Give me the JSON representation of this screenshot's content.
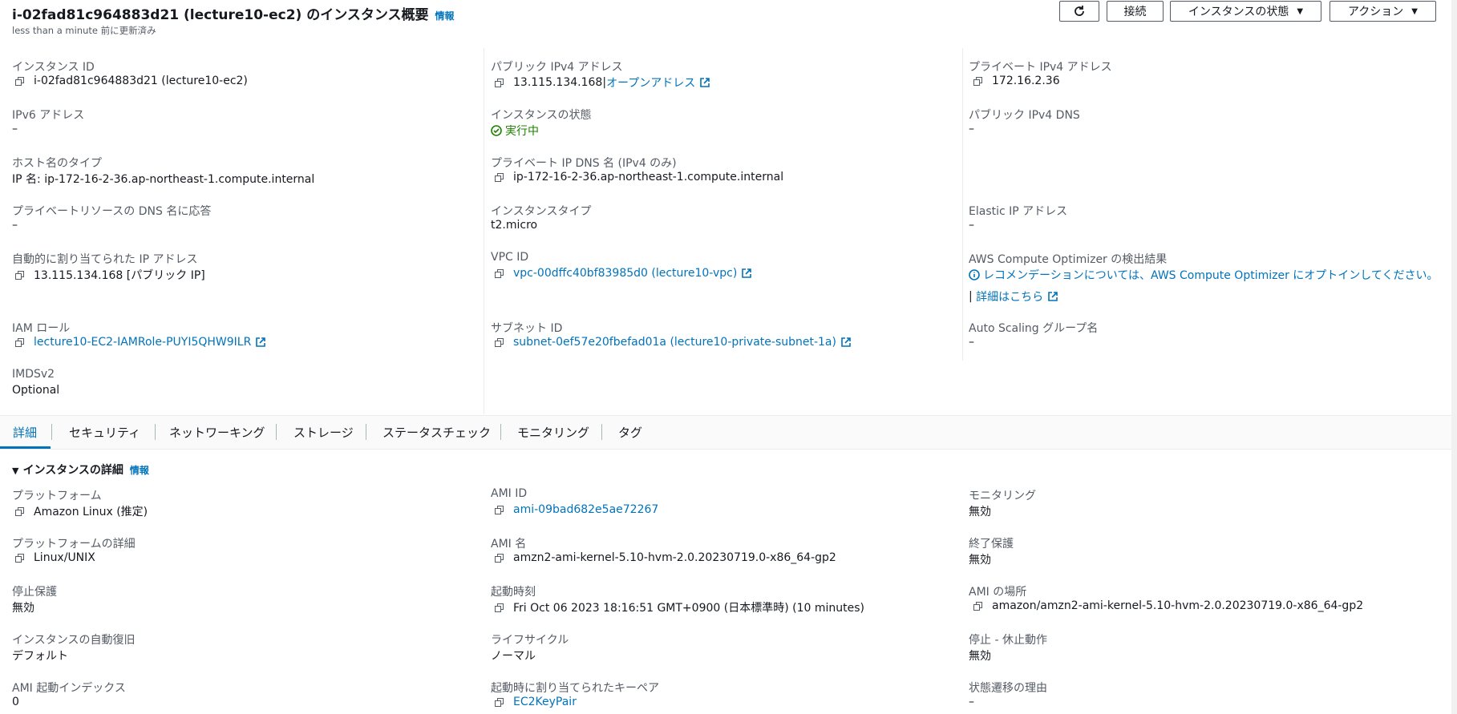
{
  "header": {
    "title": "i-02fad81c964883d21 (lecture10-ec2) のインスタンス概要",
    "info": "情報",
    "subtitle": "less than a minute 前に更新済み",
    "connect_label": "接続",
    "state_label": "インスタンスの状態",
    "actions_label": "アクション"
  },
  "summary": {
    "instance_id": {
      "label": "インスタンス ID",
      "value": "i-02fad81c964883d21 (lecture10-ec2)"
    },
    "public_ipv4": {
      "label": "パブリック IPv4 アドレス",
      "value": "13.115.134.168",
      "sep": " |",
      "link": "オープンアドレス"
    },
    "private_ipv4": {
      "label": "プライベート IPv4 アドレス",
      "value": "172.16.2.36"
    },
    "ipv6": {
      "label": "IPv6 アドレス",
      "value": "–"
    },
    "instance_state": {
      "label": "インスタンスの状態",
      "value": "実行中",
      "color": "#1d8102"
    },
    "public_dns": {
      "label": "パブリック IPv4 DNS",
      "value": "–"
    },
    "hostname_type": {
      "label": "ホスト名のタイプ",
      "value": "IP 名: ip-172-16-2-36.ap-northeast-1.compute.internal"
    },
    "private_dns": {
      "label": "プライベート IP DNS 名 (IPv4 のみ)",
      "value": "ip-172-16-2-36.ap-northeast-1.compute.internal"
    },
    "resource_dns": {
      "label": "プライベートリソースの DNS 名に応答",
      "value": "–"
    },
    "instance_type": {
      "label": "インスタンスタイプ",
      "value": "t2.micro"
    },
    "elastic_ip": {
      "label": "Elastic IP アドレス",
      "value": "–"
    },
    "auto_ip": {
      "label": "自動的に割り当てられた IP アドレス",
      "value": "13.115.134.168 [パブリック IP]"
    },
    "vpc_id": {
      "label": "VPC ID",
      "value": "vpc-00dffc40bf83985d0 (lecture10-vpc)"
    },
    "optimizer": {
      "label": "AWS Compute Optimizer の検出結果",
      "value": "レコメンデーションについては、AWS Compute Optimizer にオプトインしてください。",
      "more": "詳細はこちら"
    },
    "iam_role": {
      "label": "IAM ロール",
      "value": "lecture10-EC2-IAMRole-PUYI5QHW9ILR"
    },
    "subnet_id": {
      "label": "サブネット ID",
      "value": "subnet-0ef57e20fbefad01a (lecture10-private-subnet-1a)"
    },
    "asg_name": {
      "label": "Auto Scaling グループ名",
      "value": "–"
    },
    "imdsv2": {
      "label": "IMDSv2",
      "value": "Optional"
    }
  },
  "tabs": [
    "詳細",
    "セキュリティ",
    "ネットワーキング",
    "ストレージ",
    "ステータスチェック",
    "モニタリング",
    "タグ"
  ],
  "details": {
    "section_title": "インスタンスの詳細",
    "info": "情報",
    "platform": {
      "label": "プラットフォーム",
      "value": "Amazon Linux (推定)"
    },
    "ami_id": {
      "label": "AMI ID",
      "value": "ami-09bad682e5ae72267"
    },
    "monitoring": {
      "label": "モニタリング",
      "value": "無効"
    },
    "platform_details": {
      "label": "プラットフォームの詳細",
      "value": "Linux/UNIX"
    },
    "ami_name": {
      "label": "AMI 名",
      "value": "amzn2-ami-kernel-5.10-hvm-2.0.20230719.0-x86_64-gp2"
    },
    "termination": {
      "label": "終了保護",
      "value": "無効"
    },
    "stop_protection": {
      "label": "停止保護",
      "value": "無効"
    },
    "launch_time": {
      "label": "起動時刻",
      "value": "Fri Oct 06 2023 18:16:51 GMT+0900 (日本標準時) (10 minutes)"
    },
    "ami_location": {
      "label": "AMI の場所",
      "value": "amazon/amzn2-ami-kernel-5.10-hvm-2.0.20230719.0-x86_64-gp2"
    },
    "auto_recovery": {
      "label": "インスタンスの自動復旧",
      "value": "デフォルト"
    },
    "lifecycle": {
      "label": "ライフサイクル",
      "value": "ノーマル"
    },
    "stop_hibernate": {
      "label": "停止 - 休止動作",
      "value": "無効"
    },
    "ami_launch_index": {
      "label": "AMI 起動インデックス",
      "value": "0"
    },
    "key_pair": {
      "label": "起動時に割り当てられたキーペア",
      "value": "EC2KeyPair"
    },
    "state_reason": {
      "label": "状態遷移の理由",
      "value": "–"
    }
  },
  "colors": {
    "link": "#0073bb",
    "success": "#1d8102",
    "label": "#545b64"
  }
}
